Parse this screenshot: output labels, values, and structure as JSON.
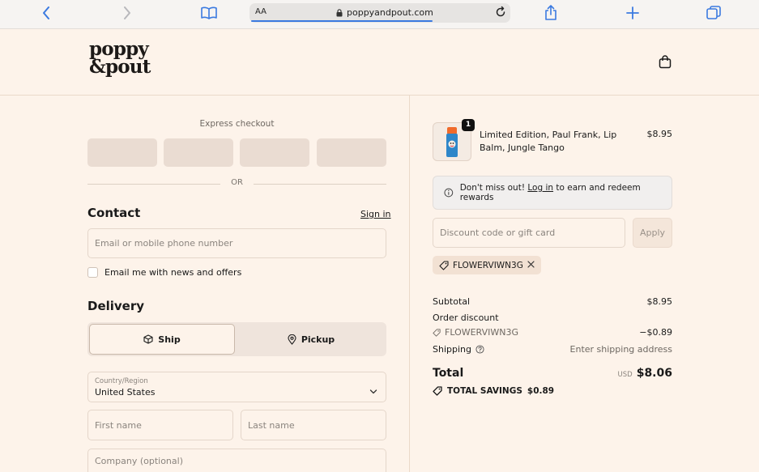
{
  "browser": {
    "reader_label": "AA",
    "url": "poppyandpout.com"
  },
  "header": {
    "logo_line1": "poppy",
    "logo_line2": "&pout"
  },
  "express": {
    "label": "Express checkout",
    "or": "OR"
  },
  "contact": {
    "title": "Contact",
    "sign_in": "Sign in",
    "email_placeholder": "Email or mobile phone number",
    "newsletter_label": "Email me with news and offers"
  },
  "delivery": {
    "title": "Delivery",
    "ship_label": "Ship",
    "pickup_label": "Pickup",
    "country_label": "Country/Region",
    "country_value": "United States",
    "first_name_placeholder": "First name",
    "last_name_placeholder": "Last name",
    "company_placeholder": "Company (optional)"
  },
  "cart": {
    "quantity": "1",
    "product_name": "Limited Edition, Paul Frank, Lip Balm, Jungle Tango",
    "product_price": "$8.95"
  },
  "rewards": {
    "text_before": "Don't miss out!",
    "link": "Log in",
    "text_after": "to earn and redeem rewards"
  },
  "discount": {
    "placeholder": "Discount code or gift card",
    "apply_label": "Apply",
    "code": "FLOWERVIWN3G"
  },
  "summary": {
    "subtotal_label": "Subtotal",
    "subtotal_value": "$8.95",
    "order_discount_label": "Order discount",
    "discount_code": "FLOWERVIWN3G",
    "discount_value": "−$0.89",
    "shipping_label": "Shipping",
    "shipping_value": "Enter shipping address",
    "total_label": "Total",
    "currency": "USD",
    "total_value": "$8.06",
    "savings_label": "TOTAL SAVINGS",
    "savings_value": "$0.89"
  },
  "colors": {
    "background": "#fdf3ea",
    "browser_accent": "#3b7ae0",
    "text": "#1a1a1a"
  }
}
